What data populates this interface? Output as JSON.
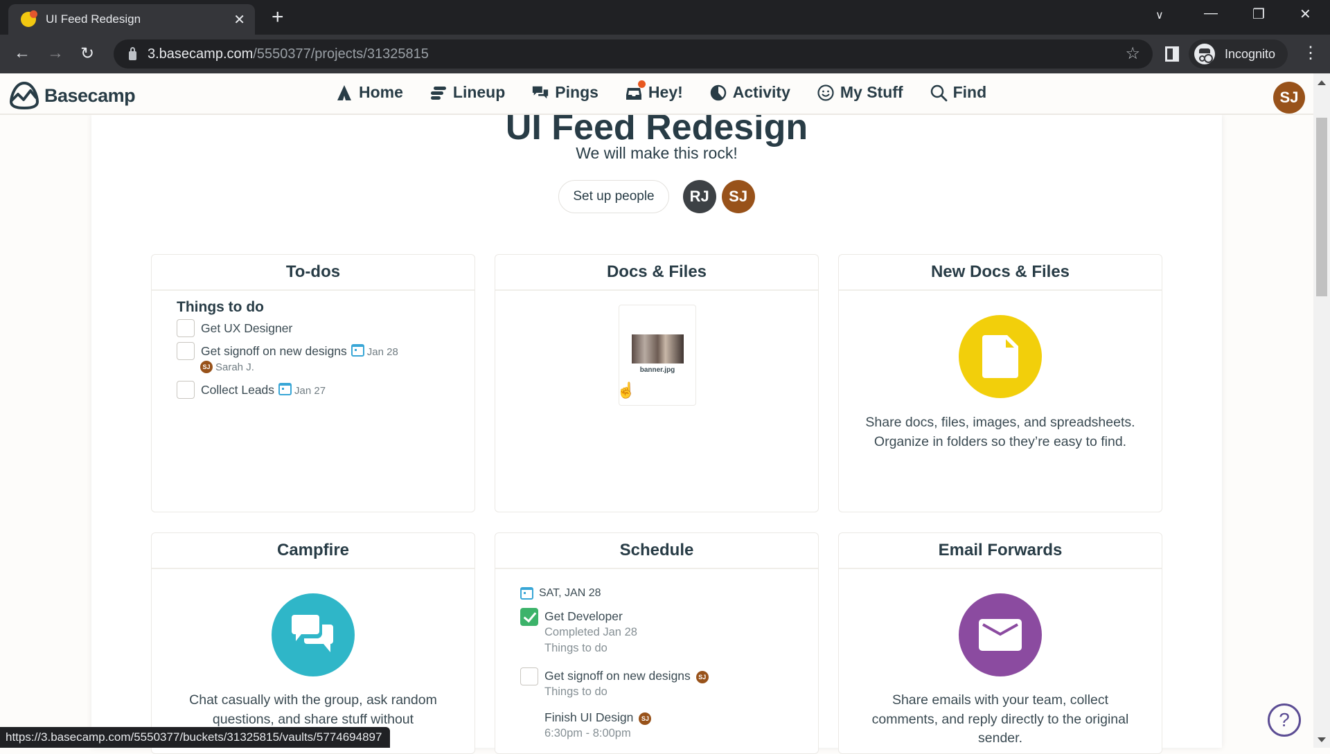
{
  "browser": {
    "tab_title": "UI Feed Redesign",
    "url_host": "3.basecamp.com",
    "url_path": "/5550377/projects/31325815",
    "profile_label": "Incognito",
    "status_url": "https://3.basecamp.com/5550377/buckets/31325815/vaults/5774694897"
  },
  "nav": {
    "logo_text": "Basecamp",
    "items": [
      {
        "label": "Home",
        "icon": "home-icon"
      },
      {
        "label": "Lineup",
        "icon": "lineup-icon"
      },
      {
        "label": "Pings",
        "icon": "pings-icon"
      },
      {
        "label": "Hey!",
        "icon": "hey-icon",
        "has_notification": true
      },
      {
        "label": "Activity",
        "icon": "activity-icon"
      },
      {
        "label": "My Stuff",
        "icon": "my-stuff-icon"
      },
      {
        "label": "Find",
        "icon": "find-icon"
      }
    ],
    "user_initials": "SJ"
  },
  "project": {
    "title": "UI Feed Redesign",
    "description": "We will make this rock!",
    "setup_people_label": "Set up people",
    "people": [
      {
        "initials": "RJ",
        "color": "#3d4145"
      },
      {
        "initials": "SJ",
        "color": "#98521a"
      }
    ]
  },
  "cards": {
    "todos": {
      "title": "To-dos",
      "list_title": "Things to do",
      "items": [
        {
          "text": "Get UX Designer",
          "checked": false,
          "due": ""
        },
        {
          "text": "Get signoff on new designs",
          "checked": false,
          "due": "Jan 28",
          "assignee": "Sarah J.",
          "assignee_initials": "SJ"
        },
        {
          "text": "Collect Leads",
          "checked": false,
          "due": "Jan 27"
        }
      ]
    },
    "docs": {
      "title": "Docs & Files",
      "files": [
        {
          "name": "banner.jpg"
        }
      ]
    },
    "new_docs": {
      "title": "New Docs & Files",
      "description": "Share docs, files, images, and spreadsheets. Organize in folders so they’re easy to find.",
      "color": "#f2cf0b"
    },
    "campfire": {
      "title": "Campfire",
      "description": "Chat casually with the group, ask random questions, and share stuff without",
      "color": "#2fb6c8"
    },
    "schedule": {
      "title": "Schedule",
      "date": "SAT, JAN 28",
      "items": [
        {
          "title": "Get Developer",
          "checked": true,
          "lines": [
            "Completed Jan 28",
            "Things to do"
          ]
        },
        {
          "title": "Get signoff on new designs",
          "checked": false,
          "assignee_initials": "SJ",
          "lines": [
            "Things to do"
          ]
        },
        {
          "title": "Finish UI Design",
          "assignee_initials": "SJ",
          "lines": [
            "6:30pm - 8:00pm"
          ]
        }
      ]
    },
    "email": {
      "title": "Email Forwards",
      "description": "Share emails with your team, collect comments, and reply directly to the original sender.",
      "color": "#8b4ba0"
    }
  },
  "help_label": "?"
}
